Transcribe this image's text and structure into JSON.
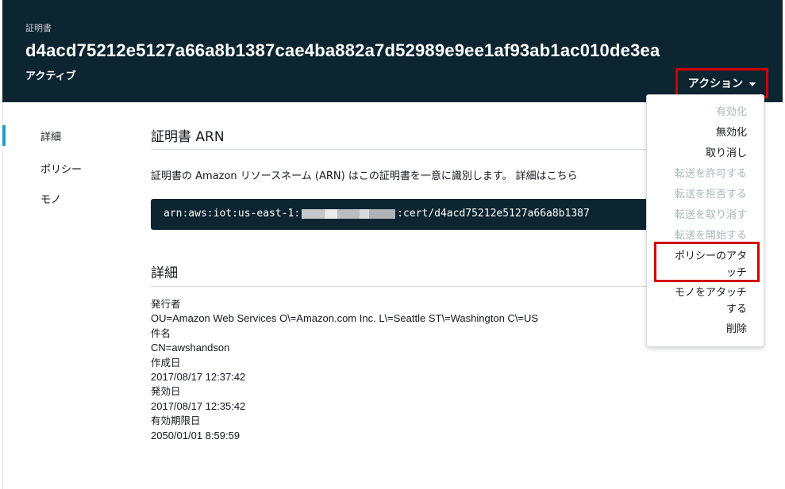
{
  "header": {
    "eyebrow": "証明書",
    "cert_id": "d4acd75212e5127a66a8b1387cae4ba882a7d52989e9ee1af93ab1ac010de3ea",
    "status": "アクティブ",
    "action_label": "アクション",
    "action_icon": "caret-down-icon"
  },
  "sidebar": {
    "items": [
      {
        "label": "詳細",
        "active": true
      },
      {
        "label": "ポリシー",
        "active": false
      },
      {
        "label": "モノ",
        "active": false
      }
    ]
  },
  "arn_section": {
    "title": "証明書 ARN",
    "description": "証明書の Amazon リソースネーム (ARN) はこの証明書を一意に識別します。",
    "more_link": "詳細はこちら",
    "arn_prefix": "arn:aws:iot:us-east-1:",
    "arn_suffix": ":cert/d4acd75212e5127a66a8b1387"
  },
  "details_section": {
    "title": "詳細",
    "fields": [
      {
        "label": "発行者",
        "value": "OU=Amazon Web Services O\\=Amazon.com Inc. L\\=Seattle ST\\=Washington C\\=US"
      },
      {
        "label": "件名",
        "value": "CN=awshandson"
      },
      {
        "label": "作成日",
        "value": "2017/08/17 12:37:42"
      },
      {
        "label": "発効日",
        "value": "2017/08/17 12:35:42"
      },
      {
        "label": "有効期限日",
        "value": "2050/01/01 8:59:59"
      }
    ]
  },
  "action_menu": {
    "items": [
      {
        "label": "有効化",
        "disabled": true
      },
      {
        "label": "無効化",
        "disabled": false
      },
      {
        "label": "取り消し",
        "disabled": false
      },
      {
        "label": "転送を許可する",
        "disabled": true
      },
      {
        "label": "転送を拒否する",
        "disabled": true
      },
      {
        "label": "転送を取り消す",
        "disabled": true
      },
      {
        "label": "転送を開始する",
        "disabled": true
      },
      {
        "label_line1": "ポリシーのアタ",
        "label_line2": "ッチ",
        "disabled": false,
        "highlighted": true
      },
      {
        "label_line1": "モノをアタッチ",
        "label_line2": "する",
        "disabled": false
      },
      {
        "label": "削除",
        "disabled": false
      }
    ]
  },
  "colors": {
    "header_bg": "#0d2530",
    "highlight": "#d00000",
    "active_nav": "#1a9ec9",
    "disabled_text": "#aab7b8"
  }
}
